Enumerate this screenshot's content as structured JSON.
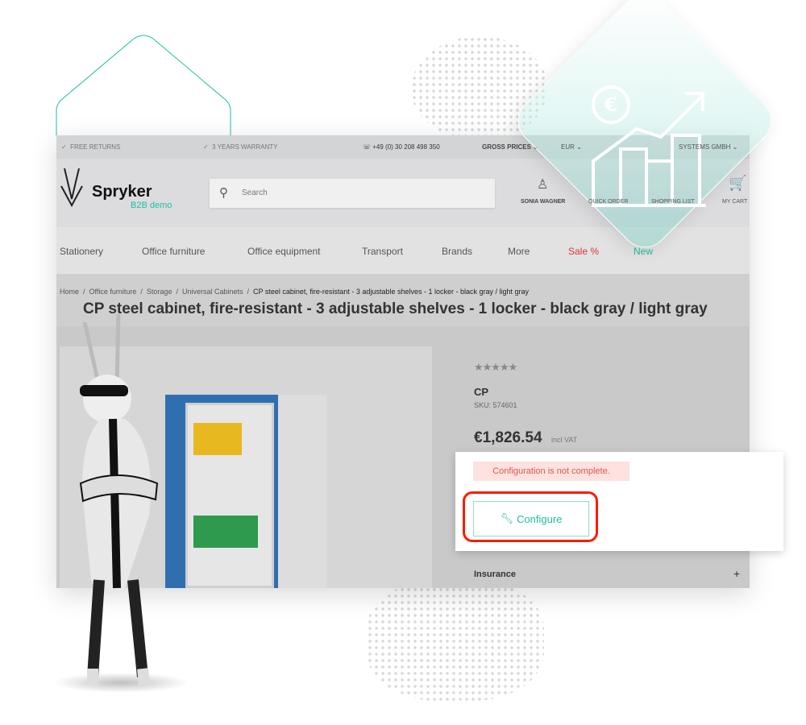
{
  "topbar": {
    "free_returns": "FREE RETURNS",
    "warranty": "3 YEARS WARRANTY",
    "phone": "+49 (0) 30 208 498 350",
    "price_mode": "GROSS PRICES",
    "currency": "EUR",
    "company": "SYSTEMS GMBH"
  },
  "header": {
    "brand": "Spryker",
    "brand_sub": "B2B demo",
    "search_placeholder": "Search",
    "user": "SONIA WAGNER",
    "quick_order": "QUICK ORDER",
    "shopping_list": "SHOPPING LIST",
    "cart": "MY CART"
  },
  "nav": [
    "Stationery",
    "Office furniture",
    "Office equipment",
    "Transport",
    "Brands",
    "More",
    "Sale %",
    "New"
  ],
  "breadcrumb": [
    "Home",
    "Office furniture",
    "Storage",
    "Universal Cabinets",
    "CP steel cabinet, fire-resistant - 3 adjustable shelves - 1 locker - black gray / light gray"
  ],
  "product": {
    "title": "CP steel cabinet, fire-resistant - 3 adjustable shelves - 1 locker - black gray / light gray",
    "rating": 0,
    "rating_max": 5,
    "brand": "CP",
    "sku": "SKU: 574601",
    "price": "€1,826.54",
    "vat": "incl VAT",
    "insurance": "Insurance"
  },
  "popup": {
    "error": "Configuration is not complete.",
    "configure": "Configure"
  },
  "colors": {
    "accent": "#1ebea5",
    "sale": "#e53935",
    "error_bg": "#fde2df",
    "error_text": "#e0564a",
    "highlight": "#ff1a00"
  }
}
